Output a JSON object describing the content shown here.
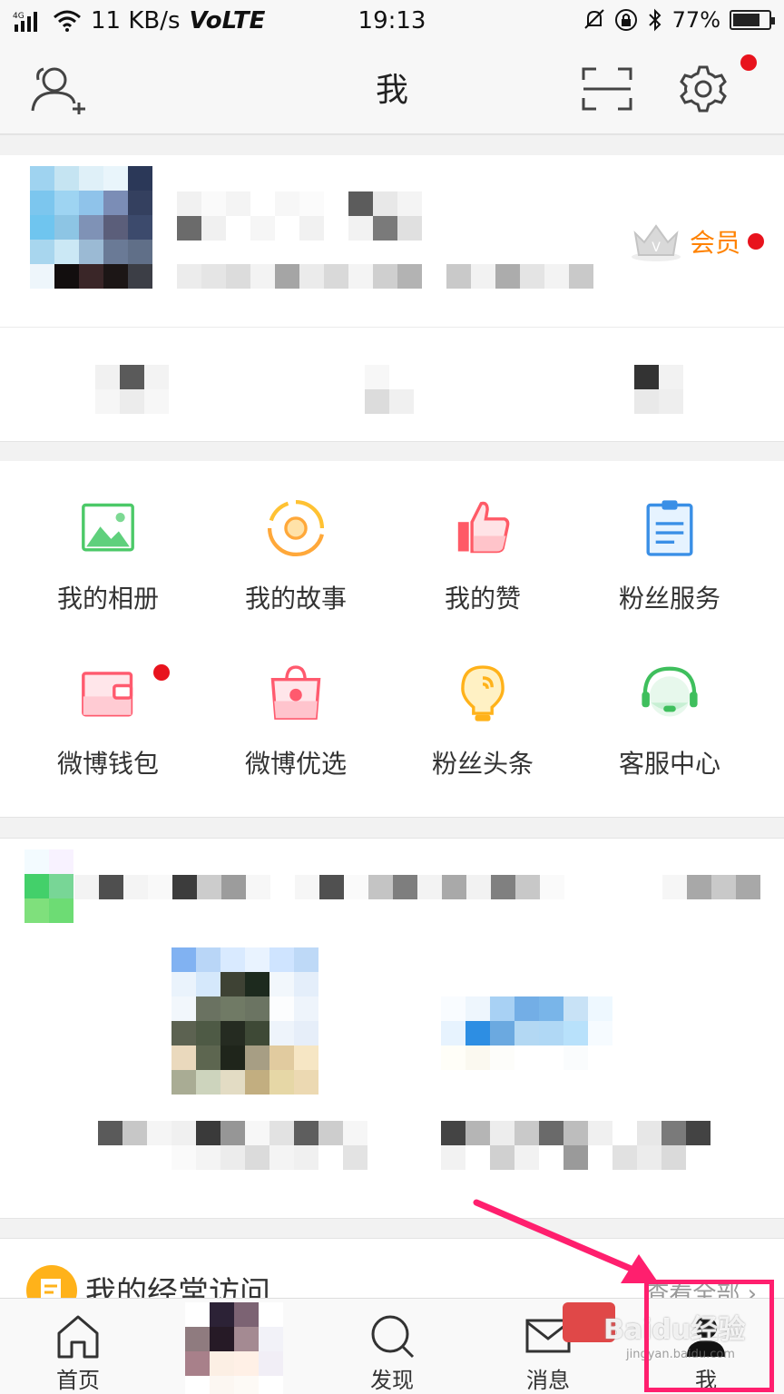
{
  "status": {
    "network": "4G",
    "speed": "11 KB/s",
    "volte": "VoLTE",
    "time": "19:13",
    "battery_percent": "77%",
    "battery_level": 0.77
  },
  "nav": {
    "title": "我"
  },
  "profile": {
    "vip_label": "会员"
  },
  "shortcuts": [
    {
      "label": "我的相册",
      "icon": "photo-album-icon"
    },
    {
      "label": "我的故事",
      "icon": "story-icon"
    },
    {
      "label": "我的赞",
      "icon": "thumbs-up-icon"
    },
    {
      "label": "粉丝服务",
      "icon": "clipboard-icon"
    },
    {
      "label": "微博钱包",
      "icon": "wallet-icon"
    },
    {
      "label": "微博优选",
      "icon": "shopping-bag-icon"
    },
    {
      "label": "粉丝头条",
      "icon": "lightbulb-icon"
    },
    {
      "label": "客服中心",
      "icon": "headset-icon"
    }
  ],
  "recent": {
    "title": "我的经常访问",
    "more": "查看全部"
  },
  "tabs": [
    {
      "label": "首页",
      "icon": "home-icon"
    },
    {
      "label": "",
      "icon": "avatar"
    },
    {
      "label": "发现",
      "icon": "search-icon"
    },
    {
      "label": "消息",
      "icon": "mail-icon"
    },
    {
      "label": "我",
      "icon": "profile-icon"
    }
  ],
  "watermark": {
    "text": "Baidu经验",
    "sub": "jingyan.baidu.com"
  },
  "colors": {
    "accent": "#ff8200",
    "highlight": "#ff1f6e",
    "badge": "#e8131d"
  }
}
